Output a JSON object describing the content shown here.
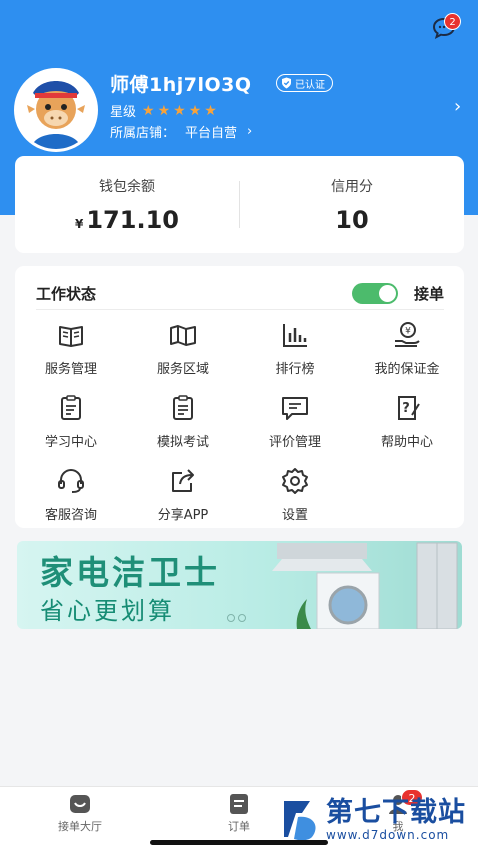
{
  "header": {
    "message_badge": "2",
    "user_name": "师傅1hj7lO3Q",
    "verified": "已认证",
    "rating_label": "星级",
    "shop_label": "所属店铺：",
    "shop_value": "平台自营",
    "star_color": "#f7a33b"
  },
  "wallet": {
    "balance_label": "钱包余额",
    "currency": "¥",
    "balance": "171.10",
    "credit_label": "信用分",
    "credit": "10"
  },
  "work": {
    "title": "工作状态",
    "toggle_label": "接单",
    "toggle_on": true,
    "items": [
      {
        "label": "服务管理",
        "icon": "book-icon"
      },
      {
        "label": "服务区域",
        "icon": "map-icon"
      },
      {
        "label": "排行榜",
        "icon": "bar-chart-icon"
      },
      {
        "label": "我的保证金",
        "icon": "deposit-icon"
      },
      {
        "label": "学习中心",
        "icon": "clipboard-icon"
      },
      {
        "label": "模拟考试",
        "icon": "exam-icon"
      },
      {
        "label": "评价管理",
        "icon": "comment-icon"
      },
      {
        "label": "帮助中心",
        "icon": "help-icon"
      },
      {
        "label": "客服咨询",
        "icon": "headset-icon"
      },
      {
        "label": "分享APP",
        "icon": "share-icon"
      },
      {
        "label": "设置",
        "icon": "gear-icon"
      }
    ]
  },
  "banner": {
    "title": "家电洁卫士",
    "subtitle": "省心更划算"
  },
  "tabbar": {
    "items": [
      {
        "label": "接单大厅",
        "icon": "hall-icon"
      },
      {
        "label": "订单",
        "icon": "order-icon"
      },
      {
        "label": "我",
        "icon": "profile-icon"
      }
    ],
    "badge": "2"
  },
  "watermark": {
    "title": "第七下载站",
    "url": "www.d7down.com"
  },
  "colors": {
    "brand": "#2e8ff0",
    "toggle": "#4cbb6c",
    "badge": "#e8322e"
  }
}
